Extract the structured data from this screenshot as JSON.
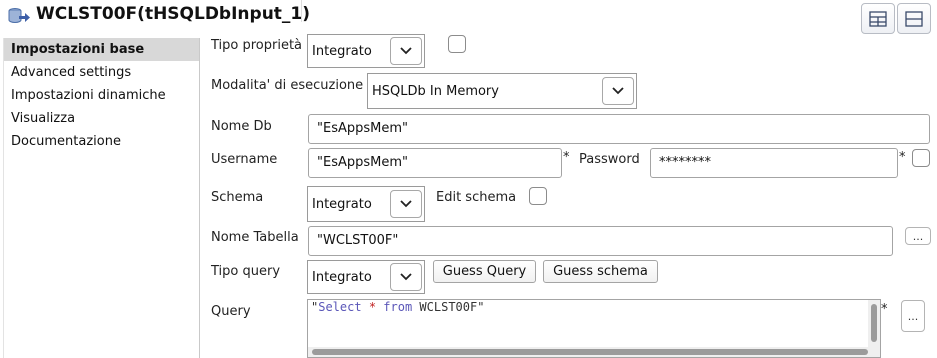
{
  "header": {
    "title": "WCLST00F(tHSQLDbInput_1)"
  },
  "sidebar": {
    "items": [
      {
        "label": "Impostazioni base",
        "active": true
      },
      {
        "label": "Advanced settings"
      },
      {
        "label": "Impostazioni dinamiche"
      },
      {
        "label": "Visualizza"
      },
      {
        "label": "Documentazione"
      }
    ]
  },
  "form": {
    "tipo_proprieta": {
      "label": "Tipo proprietà",
      "value": "Integrato"
    },
    "modalita": {
      "label": "Modalita' di esecuzione",
      "value": "HSQLDb In Memory"
    },
    "nome_db": {
      "label": "Nome Db",
      "value": "\"EsAppsMem\""
    },
    "username": {
      "label": "Username",
      "value": "\"EsAppsMem\"",
      "required": "*"
    },
    "password": {
      "label": "Password",
      "value": "********",
      "required": "*"
    },
    "schema": {
      "label": "Schema",
      "value": "Integrato"
    },
    "edit_schema": {
      "label": "Edit schema"
    },
    "nome_tabella": {
      "label": "Nome Tabella",
      "value": "\"WCLST00F\""
    },
    "tipo_query": {
      "label": "Tipo query",
      "value": "Integrato"
    },
    "guess_query": {
      "label": "Guess Query"
    },
    "guess_schema": {
      "label": "Guess schema"
    },
    "query": {
      "label": "Query",
      "required": "*",
      "parts": [
        "\"",
        "Select",
        " ",
        "*",
        " ",
        "from",
        " WCLST00F\""
      ]
    },
    "ellipsis": "..."
  }
}
